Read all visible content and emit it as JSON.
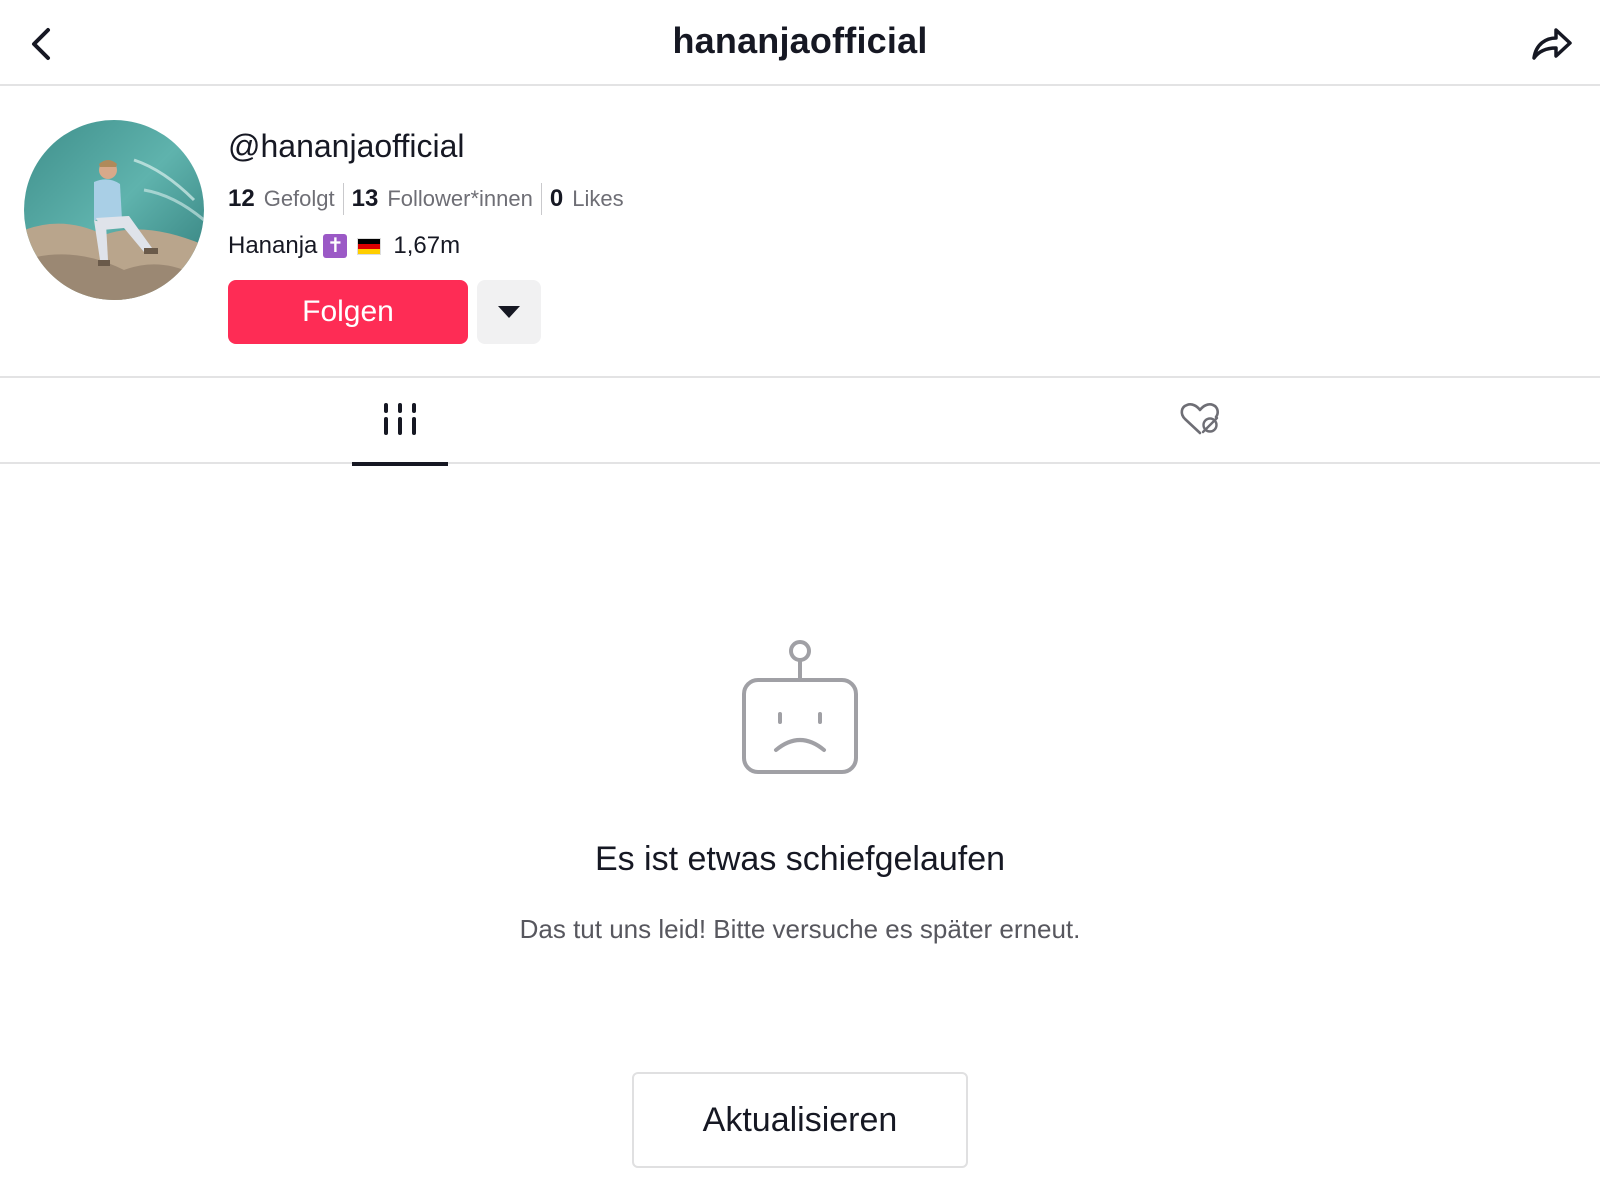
{
  "header": {
    "title": "hananjaofficial",
    "back_icon": "chevron-left-icon",
    "share_icon": "share-arrow-icon"
  },
  "profile": {
    "handle": "@hananjaofficial",
    "stats": [
      {
        "value": "12",
        "label": "Gefolgt"
      },
      {
        "value": "13",
        "label": "Follower*innen"
      },
      {
        "value": "0",
        "label": "Likes"
      }
    ],
    "bio_name": "Hananja",
    "bio_cross": "✝",
    "bio_height": "1,67m",
    "follow_label": "Folgen",
    "more_icon": "caret-down-icon"
  },
  "tabs": {
    "videos_icon": "grid-icon",
    "liked_icon": "heart-hidden-icon",
    "active": "videos"
  },
  "error": {
    "icon": "sad-robot-icon",
    "title": "Es ist etwas schiefgelaufen",
    "subtitle": "Das tut uns leid! Bitte versuche es später erneut.",
    "refresh_label": "Aktualisieren"
  },
  "colors": {
    "accent": "#fe2c55",
    "text": "#161823",
    "muted": "#6e6e75",
    "divider": "#e3e3e4"
  }
}
